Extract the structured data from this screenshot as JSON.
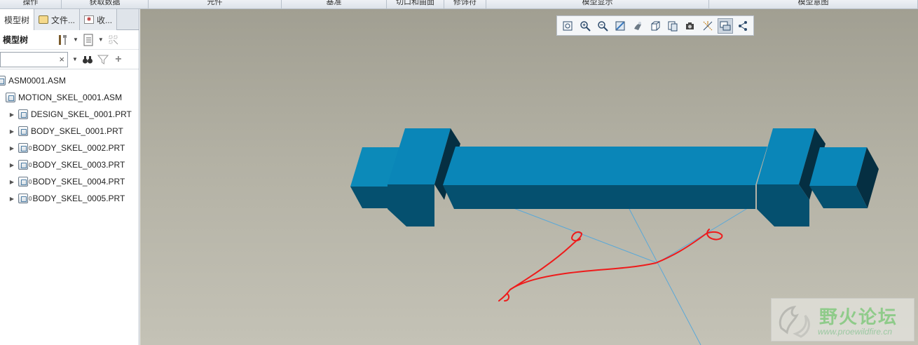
{
  "ribbon": {
    "groups": [
      "操作",
      "获取数据",
      "元件",
      "基准",
      "切口和曲面",
      "修饰符",
      "模型显示",
      "模型意图"
    ]
  },
  "panel": {
    "tabs": [
      {
        "label": "模型树",
        "icon": "model-tree-icon"
      },
      {
        "label": "文件...",
        "icon": "folder-icon"
      },
      {
        "label": "收...",
        "icon": "favorites-icon"
      }
    ],
    "toolbar_label": "模型树",
    "search": {
      "value": "",
      "clear": "×"
    },
    "tree": [
      {
        "label": "ASM0001.ASM",
        "level": 0,
        "expand": "",
        "icon": "assembly-icon",
        "mark": ""
      },
      {
        "label": "MOTION_SKEL_0001.ASM",
        "level": 1,
        "expand": "",
        "icon": "skeleton-assembly-icon",
        "mark": ""
      },
      {
        "label": "DESIGN_SKEL_0001.PRT",
        "level": 2,
        "expand": "▶",
        "icon": "part-icon",
        "mark": ""
      },
      {
        "label": "BODY_SKEL_0001.PRT",
        "level": 2,
        "expand": "▶",
        "icon": "part-icon",
        "mark": ""
      },
      {
        "label": "BODY_SKEL_0002.PRT",
        "level": 2,
        "expand": "▶",
        "icon": "part-icon",
        "mark": "0"
      },
      {
        "label": "BODY_SKEL_0003.PRT",
        "level": 2,
        "expand": "▶",
        "icon": "part-icon",
        "mark": "0"
      },
      {
        "label": "BODY_SKEL_0004.PRT",
        "level": 2,
        "expand": "▶",
        "icon": "part-icon",
        "mark": "0"
      },
      {
        "label": "BODY_SKEL_0005.PRT",
        "level": 2,
        "expand": "▶",
        "icon": "part-icon",
        "mark": "0"
      }
    ]
  },
  "viewport": {
    "toolbar_icons": [
      "refit-icon",
      "zoom-in-icon",
      "zoom-out-icon",
      "repaint-icon",
      "display-style-icon",
      "saved-orientations-icon",
      "view-manager-icon",
      "perspective-view-icon",
      "datum-display-icon",
      "annotation-display-icon",
      "spin-center-icon"
    ],
    "model_color": "#0a86b8",
    "annotation_color": "#ee1b1b"
  },
  "watermark": {
    "title": "野火论坛",
    "url": "www.proewildfire.cn"
  }
}
